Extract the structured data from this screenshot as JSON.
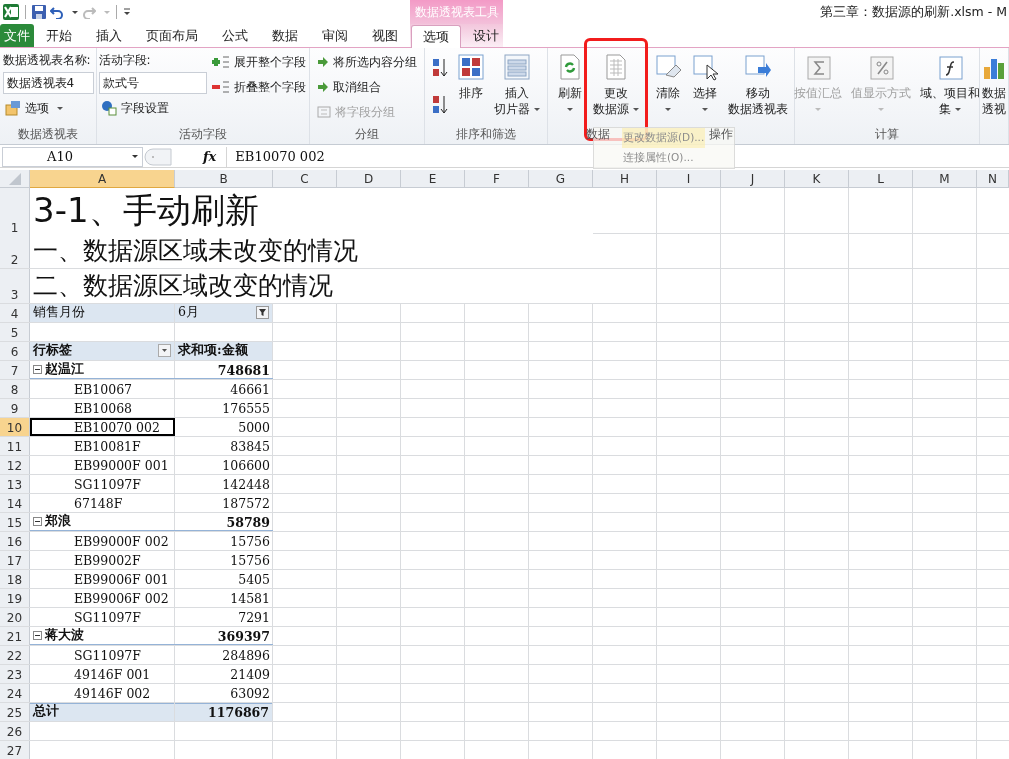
{
  "window": {
    "title": "第三章：数据源的刷新.xlsm - M"
  },
  "context_tab": "数据透视表工具",
  "tabs": [
    {
      "label": "文件",
      "kind": "file",
      "selected": false
    },
    {
      "label": "开始",
      "kind": "normal",
      "selected": false
    },
    {
      "label": "插入",
      "kind": "normal",
      "selected": false
    },
    {
      "label": "页面布局",
      "kind": "normal",
      "selected": false
    },
    {
      "label": "公式",
      "kind": "normal",
      "selected": false
    },
    {
      "label": "数据",
      "kind": "normal",
      "selected": false
    },
    {
      "label": "审阅",
      "kind": "normal",
      "selected": false
    },
    {
      "label": "视图",
      "kind": "normal",
      "selected": false
    },
    {
      "label": "选项",
      "kind": "context",
      "selected": true
    },
    {
      "label": "设计",
      "kind": "context",
      "selected": false
    }
  ],
  "ribbon": [
    {
      "label": "数据透视表",
      "columns": [
        [
          {
            "kind": "caption",
            "label": "数据透视表名称:"
          },
          {
            "kind": "field",
            "value": "数据透视表4"
          },
          {
            "kind": "small",
            "label": "选项",
            "dropdown": true,
            "disabled": false
          }
        ]
      ]
    },
    {
      "label": "活动字段",
      "columns": [
        [
          {
            "kind": "caption",
            "label": "活动字段:"
          },
          {
            "kind": "field",
            "value": "款式号"
          },
          {
            "kind": "small",
            "label": "字段设置",
            "dropdown": false,
            "disabled": false
          }
        ],
        [
          {
            "kind": "small",
            "label": "展开整个字段",
            "dropdown": false,
            "disabled": false
          },
          {
            "kind": "small",
            "label": "折叠整个字段",
            "dropdown": false,
            "disabled": false
          }
        ]
      ]
    },
    {
      "label": "分组",
      "columns": [
        [
          {
            "kind": "small",
            "label": "将所选内容分组",
            "dropdown": false,
            "disabled": false
          },
          {
            "kind": "small",
            "label": "取消组合",
            "dropdown": false,
            "disabled": false
          },
          {
            "kind": "small",
            "label": "将字段分组",
            "dropdown": false,
            "disabled": true
          }
        ]
      ]
    },
    {
      "label": "排序和筛选",
      "columns": [
        [
          {
            "kind": "icon",
            "disabled": false
          },
          {
            "kind": "icon",
            "disabled": false
          }
        ],
        [
          {
            "kind": "large",
            "lines": [
              "排序"
            ],
            "dropdown": false,
            "disabled": false
          }
        ],
        [
          {
            "kind": "large",
            "lines": [
              "插入",
              "切片器"
            ],
            "dropdown": true,
            "disabled": false
          }
        ]
      ]
    },
    {
      "label": "数据",
      "columns": [
        [
          {
            "kind": "large",
            "lines": [
              "刷新"
            ],
            "dropdown": true,
            "disabled": false
          }
        ],
        [
          {
            "kind": "large",
            "lines": [
              "更改",
              "数据源"
            ],
            "dropdown": true,
            "disabled": false,
            "highlighted": true
          }
        ]
      ]
    },
    {
      "label": "操作",
      "columns": [
        [
          {
            "kind": "large",
            "lines": [
              "清除"
            ],
            "dropdown": true,
            "disabled": false
          }
        ],
        [
          {
            "kind": "large",
            "lines": [
              "选择"
            ],
            "dropdown": true,
            "disabled": false
          }
        ],
        [
          {
            "kind": "large",
            "lines": [
              "移动",
              "数据透视表"
            ],
            "dropdown": false,
            "disabled": false
          }
        ]
      ]
    },
    {
      "label": "计算",
      "columns": [
        [
          {
            "kind": "large",
            "lines": [
              "按值汇总"
            ],
            "dropdown": true,
            "disabled": true
          }
        ],
        [
          {
            "kind": "large",
            "lines": [
              "值显示方式"
            ],
            "dropdown": true,
            "disabled": true
          }
        ],
        [
          {
            "kind": "large",
            "lines": [
              "域、项目和",
              "集"
            ],
            "dropdown": true,
            "disabled": false
          }
        ]
      ]
    },
    {
      "columns": [
        [
          {
            "kind": "large",
            "lines": [
              "数据",
              "透视"
            ],
            "dropdown": false,
            "disabled": false
          }
        ]
      ]
    }
  ],
  "menu": {
    "items": [
      {
        "label": "更改数据源(D)...",
        "selected": true,
        "disabled": true
      },
      {
        "label": "连接属性(O)...",
        "selected": false,
        "disabled": true
      }
    ]
  },
  "formula_bar": {
    "name_box": "A10",
    "function_label": "fx",
    "value": "EB10070 002"
  },
  "sheet": {
    "columns": [
      {
        "label": "A",
        "selected": true
      },
      {
        "label": "B",
        "selected": false
      },
      {
        "label": "C",
        "selected": false
      },
      {
        "label": "D",
        "selected": false
      },
      {
        "label": "E",
        "selected": false
      },
      {
        "label": "F",
        "selected": false
      },
      {
        "label": "G",
        "selected": false
      },
      {
        "label": "H",
        "selected": false
      },
      {
        "label": "I",
        "selected": false
      },
      {
        "label": "J",
        "selected": false
      },
      {
        "label": "K",
        "selected": false
      },
      {
        "label": "L",
        "selected": false
      },
      {
        "label": "M",
        "selected": false
      },
      {
        "label": "N",
        "selected": false
      }
    ],
    "rows": [
      {
        "number": "1",
        "kind": "heading1",
        "selected": false,
        "a": "3-1、手动刷新"
      },
      {
        "number": "2",
        "kind": "heading2",
        "selected": false,
        "a": "一、数据源区域未改变的情况"
      },
      {
        "number": "3",
        "kind": "heading2",
        "selected": false,
        "a": "二、数据源区域改变的情况"
      },
      {
        "number": "4",
        "kind": "filter",
        "selected": false,
        "a": "销售月份",
        "b": "6月"
      },
      {
        "number": "5",
        "kind": "blank",
        "selected": false
      },
      {
        "number": "6",
        "kind": "header",
        "selected": false,
        "a": "行标签",
        "b": "求和项:金额"
      },
      {
        "number": "7",
        "kind": "group",
        "selected": false,
        "expanded": true,
        "a": "赵温江",
        "b": "748681"
      },
      {
        "number": "8",
        "kind": "item",
        "selected": false,
        "a": "EB10067",
        "b": "46661"
      },
      {
        "number": "9",
        "kind": "item",
        "selected": false,
        "a": "EB10068",
        "b": "176555"
      },
      {
        "number": "10",
        "kind": "item",
        "selected": true,
        "a": "EB10070 002",
        "b": "5000"
      },
      {
        "number": "11",
        "kind": "item",
        "selected": false,
        "a": "EB10081F",
        "b": "83845"
      },
      {
        "number": "12",
        "kind": "item",
        "selected": false,
        "a": "EB99000F 001",
        "b": "106600"
      },
      {
        "number": "13",
        "kind": "item",
        "selected": false,
        "a": "SG11097F",
        "b": "142448"
      },
      {
        "number": "14",
        "kind": "item",
        "selected": false,
        "a": "67148F",
        "b": "187572"
      },
      {
        "number": "15",
        "kind": "group",
        "selected": false,
        "expanded": true,
        "a": "郑浪",
        "b": "58789"
      },
      {
        "number": "16",
        "kind": "item",
        "selected": false,
        "a": "EB99000F 002",
        "b": "15756"
      },
      {
        "number": "17",
        "kind": "item",
        "selected": false,
        "a": "EB99002F",
        "b": "15756"
      },
      {
        "number": "18",
        "kind": "item",
        "selected": false,
        "a": "EB99006F 001",
        "b": "5405"
      },
      {
        "number": "19",
        "kind": "item",
        "selected": false,
        "a": "EB99006F 002",
        "b": "14581"
      },
      {
        "number": "20",
        "kind": "item",
        "selected": false,
        "a": "SG11097F",
        "b": "7291"
      },
      {
        "number": "21",
        "kind": "group",
        "selected": false,
        "expanded": true,
        "a": "蒋大波",
        "b": "369397"
      },
      {
        "number": "22",
        "kind": "item",
        "selected": false,
        "a": "SG11097F",
        "b": "284896"
      },
      {
        "number": "23",
        "kind": "item",
        "selected": false,
        "a": "49146F 001",
        "b": "21409"
      },
      {
        "number": "24",
        "kind": "item",
        "selected": false,
        "a": "49146F 002",
        "b": "63092"
      },
      {
        "number": "25",
        "kind": "total",
        "selected": false,
        "a": "总计",
        "b": "1176867"
      },
      {
        "number": "26",
        "kind": "blank",
        "selected": false
      },
      {
        "number": "27",
        "kind": "blank",
        "selected": false
      }
    ]
  }
}
